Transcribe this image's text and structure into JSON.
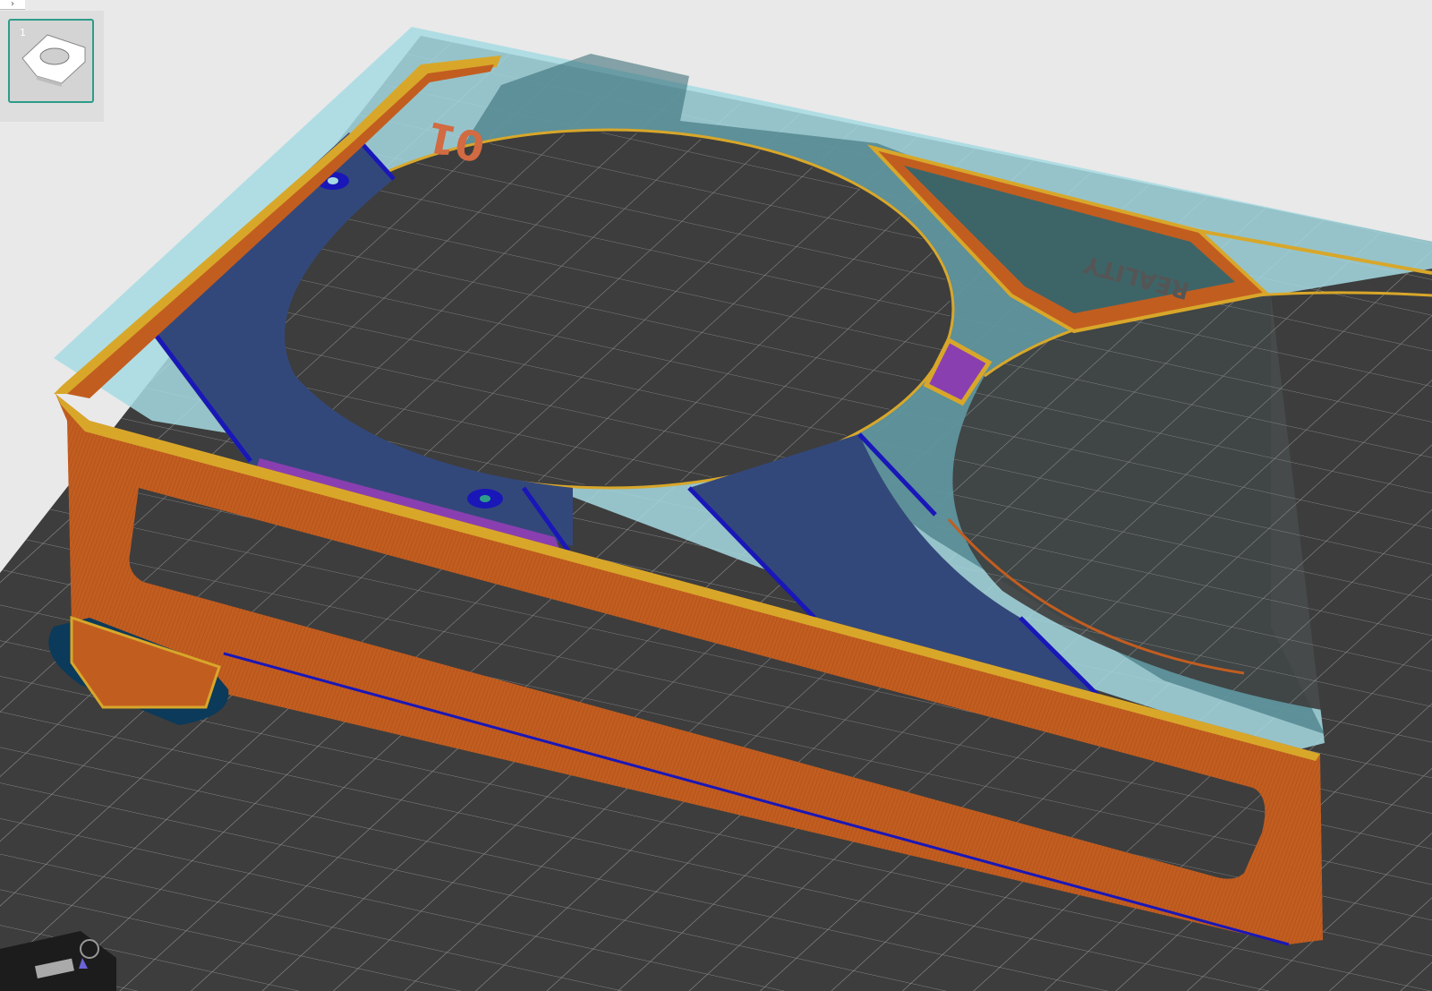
{
  "viewport": {
    "plate_numbers": [
      "01"
    ],
    "plate_brand": "REALITY"
  },
  "plate_panel": {
    "selected_plate_index": "1"
  },
  "colors": {
    "background": "#e9e9e9",
    "build_plate": "#3d3d3d",
    "grid_lines": "#9a9a9a",
    "model_preview": "#a6dbe3",
    "wall_orange": "#c25d20",
    "wall_outer_yellow": "#d8a72a",
    "infill_blue": "#33487a",
    "skirt_blue": "#1a17b8",
    "support_purple": "#8a3fb0",
    "thumbnail_border": "#2e9c8a"
  },
  "icons": [
    "chevron-icon",
    "plate-thumbnail-icon",
    "axis-gizmo-icon"
  ]
}
